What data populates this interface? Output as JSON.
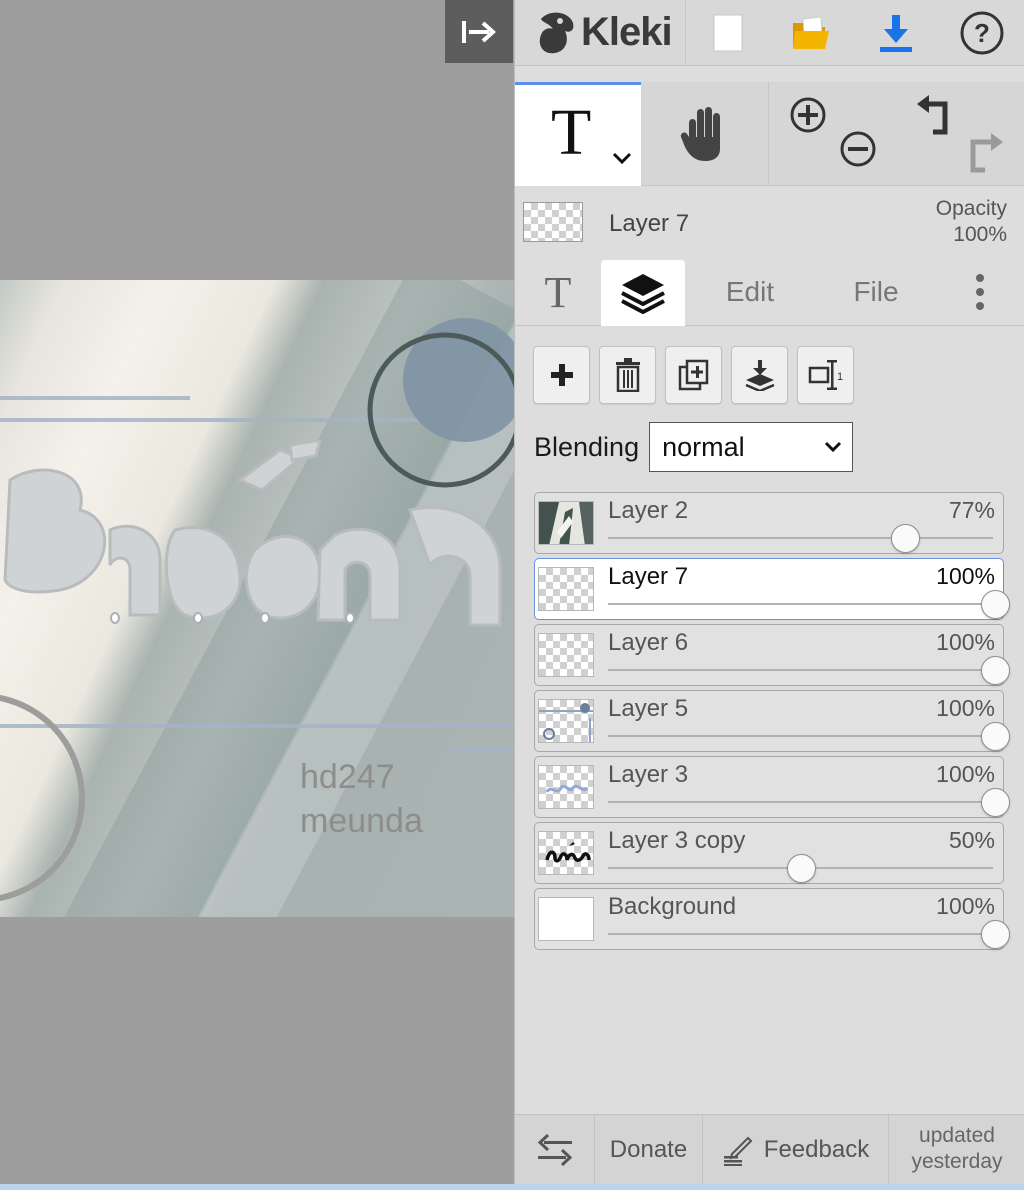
{
  "app": {
    "name": "Kleki"
  },
  "canvas": {
    "artwork_text_line1": "hd247",
    "artwork_text_line2": "meunda"
  },
  "topbar": {
    "logo_text": "Kleki",
    "buttons": [
      "new-image",
      "open-image",
      "save-download",
      "help"
    ]
  },
  "tools": {
    "active_tool": "text",
    "text_tool_glyph": "T",
    "hand_tool": "hand"
  },
  "layer_info": {
    "name": "Layer 7",
    "opacity_label": "Opacity",
    "opacity_value": "100%"
  },
  "tabs": {
    "text_glyph": "T",
    "edit": "Edit",
    "file": "File",
    "active": "layers"
  },
  "layer_panel": {
    "blending_label": "Blending",
    "blending_value": "normal",
    "layers": [
      {
        "name": "Layer 2",
        "opacity": "77%",
        "opacity_value": 0.77,
        "active": false,
        "thumb": "photo"
      },
      {
        "name": "Layer 7",
        "opacity": "100%",
        "opacity_value": 1.0,
        "active": true,
        "thumb": "transparent"
      },
      {
        "name": "Layer 6",
        "opacity": "100%",
        "opacity_value": 1.0,
        "active": false,
        "thumb": "transparent"
      },
      {
        "name": "Layer 5",
        "opacity": "100%",
        "opacity_value": 1.0,
        "active": false,
        "thumb": "shapes"
      },
      {
        "name": "Layer 3",
        "opacity": "100%",
        "opacity_value": 1.0,
        "active": false,
        "thumb": "bluetext"
      },
      {
        "name": "Layer 3 copy",
        "opacity": "50%",
        "opacity_value": 0.5,
        "active": false,
        "thumb": "blacktext"
      },
      {
        "name": "Background",
        "opacity": "100%",
        "opacity_value": 1.0,
        "active": false,
        "thumb": "white"
      }
    ]
  },
  "footer": {
    "donate": "Donate",
    "feedback": "Feedback",
    "updated_line1": "updated",
    "updated_line2": "yesterday"
  },
  "colors": {
    "accent": "#5b8ff0",
    "download_icon": "#1a73e8",
    "folder_icon": "#f2b400",
    "sidebar_bg": "#dddddd",
    "canvas_bg": "#9e9e9e"
  }
}
